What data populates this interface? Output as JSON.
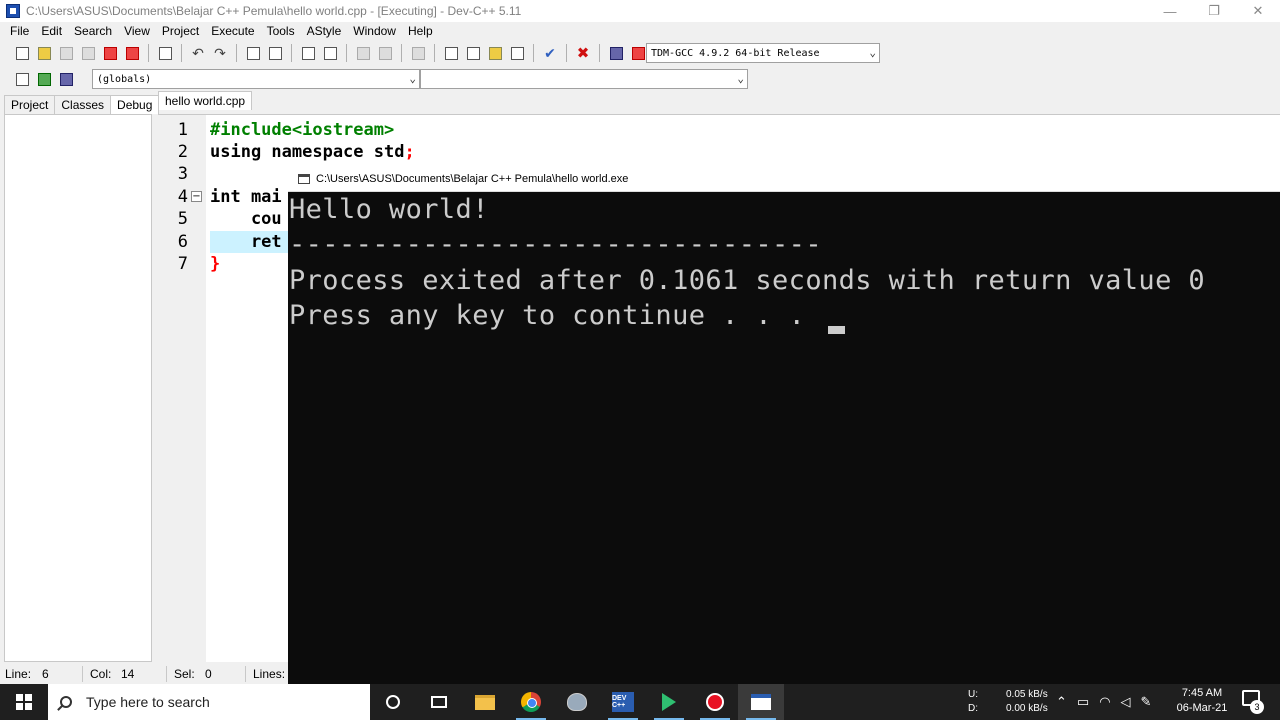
{
  "window": {
    "title": "C:\\Users\\ASUS\\Documents\\Belajar C++ Pemula\\hello world.cpp - [Executing] - Dev-C++ 5.11",
    "minimize": "—",
    "restore": "❐",
    "close": "✕"
  },
  "menu": [
    "File",
    "Edit",
    "Search",
    "View",
    "Project",
    "Execute",
    "Tools",
    "AStyle",
    "Window",
    "Help"
  ],
  "toolbar": {
    "compiler_select": "TDM-GCC 4.9.2 64-bit Release",
    "scope_select": "(globals)",
    "function_select": ""
  },
  "left_panel": {
    "tabs": [
      "Project",
      "Classes",
      "Debug"
    ],
    "active_tab": "Debug"
  },
  "editor": {
    "tab": "hello world.cpp",
    "lines": [
      {
        "num": "1",
        "code": "#include<iostream>"
      },
      {
        "num": "2",
        "code": "using namespace std",
        "sym": ";"
      },
      {
        "num": "3",
        "code": ""
      },
      {
        "num": "4",
        "code": "int mai",
        "fold": "−"
      },
      {
        "num": "5",
        "code": "    cou"
      },
      {
        "num": "6",
        "code": "    ret"
      },
      {
        "num": "7",
        "code": "",
        "sym": "}"
      }
    ],
    "highlight_line": 6
  },
  "status": {
    "line_label": "Line:",
    "line_value": "6",
    "col_label": "Col:",
    "col_value": "14",
    "sel_label": "Sel:",
    "sel_value": "0",
    "lines_label": "Lines:"
  },
  "console": {
    "title": "C:\\Users\\ASUS\\Documents\\Belajar C++ Pemula\\hello world.exe",
    "output": [
      "Hello world!",
      "--------------------------------",
      "Process exited after 0.1061 seconds with return value 0",
      "Press any key to continue . . . "
    ]
  },
  "taskbar": {
    "search_placeholder": "Type here to search",
    "devcpp_label": "DEV C++",
    "upload_label": "U:",
    "download_label": "D:",
    "upload_speed": "0.05 kB/s",
    "download_speed": "0.00 kB/s",
    "time": "7:45 AM",
    "date": "06-Mar-21",
    "notifications": "3"
  }
}
